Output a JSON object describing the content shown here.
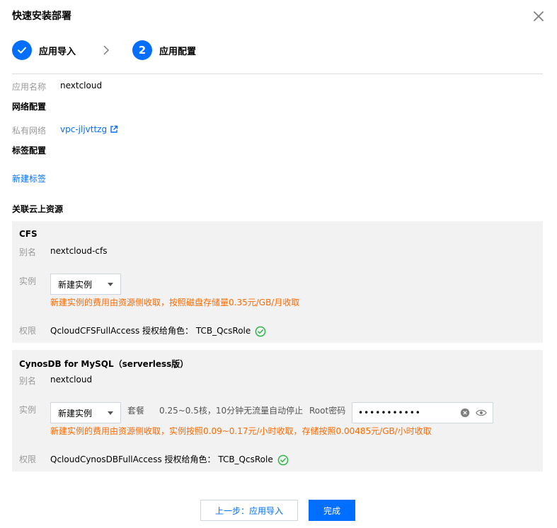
{
  "dialog": {
    "title": "快速安装部署"
  },
  "steps": [
    {
      "label": "应用导入",
      "state": "done"
    },
    {
      "number": "2",
      "label": "应用配置",
      "state": "active"
    }
  ],
  "app": {
    "name_label": "应用名称",
    "name_value": "nextcloud"
  },
  "network": {
    "section_title": "网络配置",
    "vpc_label": "私有网络",
    "vpc_value": "vpc-jljvttzg"
  },
  "tags": {
    "section_title": "标签配置",
    "add_link": "新建标签"
  },
  "resources": {
    "section_title": "关联云上资源"
  },
  "cfs": {
    "title": "CFS",
    "alias_label": "别名",
    "alias_value": "nextcloud-cfs",
    "instance_label": "实例",
    "instance_select": "新建实例",
    "instance_note": "新建实例的费用由资源侧收取，按照磁盘存储量0.35元/GB/月收取",
    "permission_label": "权限",
    "permission_value": "QcloudCFSFullAccess 授权给角色：  TCB_QcsRole"
  },
  "cynosdb": {
    "title": "CynosDB for MySQL（serverless版）",
    "alias_label": "别名",
    "alias_value": "nextcloud",
    "instance_label": "实例",
    "instance_select": "新建实例",
    "package_label": "套餐",
    "package_value": "0.25~0.5核，10分钟无流量自动停止",
    "root_password_label": "Root密码",
    "root_password_value": "•••••••••••",
    "instance_note": "新建实例的费用由资源侧收取，实例按照0.09~0.17元/小时收取，存储按照0.00485元/GB/小时收取",
    "permission_label": "权限",
    "permission_value": "QcloudCynosDBFullAccess 授权给角色：  TCB_QcsRole"
  },
  "footer": {
    "prev_button": "上一步：应用导入",
    "finish_button": "完成"
  },
  "colors": {
    "primary": "#006eff",
    "warning": "#ff6a00",
    "success": "#2bb84a",
    "panel": "#f2f2f2"
  }
}
